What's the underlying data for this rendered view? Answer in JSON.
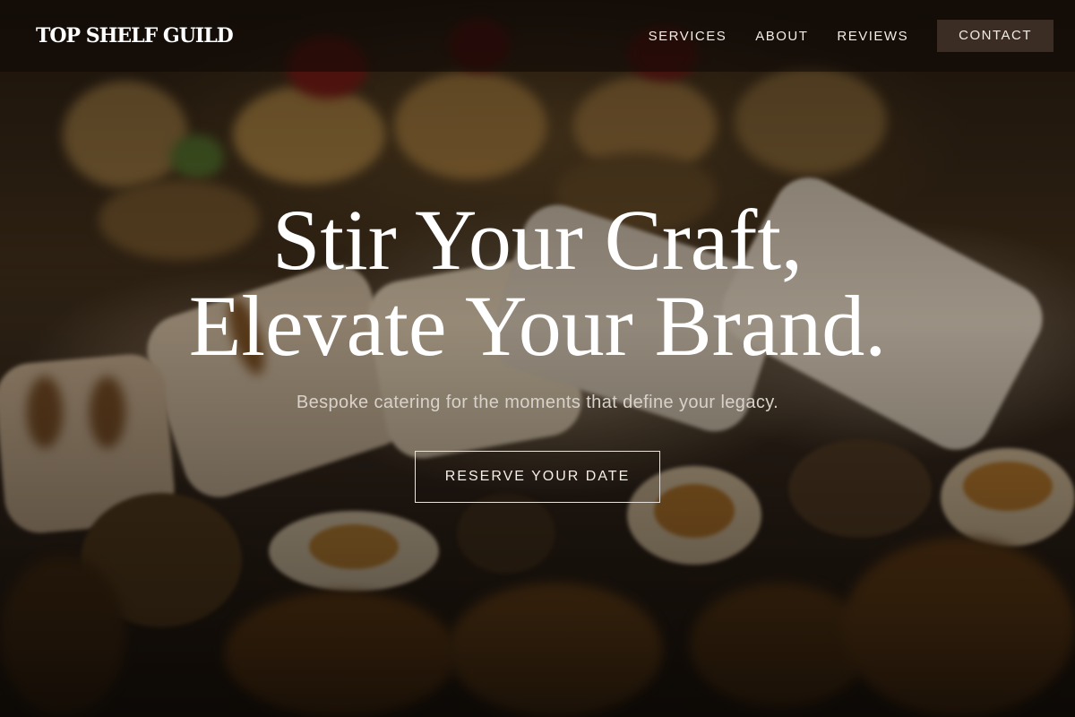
{
  "brand": {
    "name": "TOP SHELF GUILD"
  },
  "nav": {
    "items": [
      {
        "label": "SERVICES"
      },
      {
        "label": "ABOUT"
      },
      {
        "label": "REVIEWS"
      }
    ],
    "contact_label": "CONTACT"
  },
  "hero": {
    "headline_line1": "Stir Your Craft,",
    "headline_line2": "Elevate Your Brand.",
    "subtitle": "Bespoke catering for the moments that define your legacy.",
    "cta_label": "RESERVE YOUR DATE",
    "background_image": "catering-food-platter-photo"
  },
  "colors": {
    "overlay": "#0c0805",
    "contact_button_bg": "#3b2d24",
    "text_primary": "#ffffff",
    "text_secondary": "#d9d2ca"
  }
}
